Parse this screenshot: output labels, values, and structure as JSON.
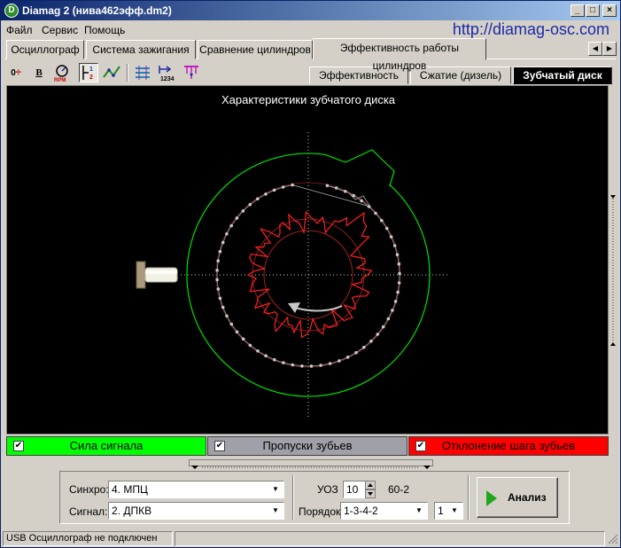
{
  "window": {
    "title": "Diamag 2 (нива462эфф.dm2)",
    "controls": [
      "_",
      "□",
      "×"
    ]
  },
  "menu": [
    "Файл",
    "Сервис",
    "Помощь"
  ],
  "site_url": "http://diamag-osc.com",
  "main_tabs": [
    {
      "label": "Осциллограф"
    },
    {
      "label": "Система зажигания"
    },
    {
      "label": "Сравнение цилиндров"
    },
    {
      "label": "Эффективность работы цилиндров",
      "active": true
    }
  ],
  "toolbar_icons": [
    "zero-offset-icon",
    "bold-icon",
    "rpm-icon",
    "channel-scale-icon",
    "curve-icon",
    "grid-icon",
    "cylinder-numbering-icon",
    "marker-icon"
  ],
  "sub_tabs": [
    {
      "label": "Эффективность"
    },
    {
      "label": "Сжатие (дизель)"
    },
    {
      "label": "Зубчатый диск",
      "active": true
    }
  ],
  "plot": {
    "title": "Характеристики зубчатого диска"
  },
  "legend": [
    {
      "label": "Сила сигнала",
      "checked": true,
      "color": "#00ff00"
    },
    {
      "label": "Пропуски зубьев",
      "checked": true,
      "color": "#a0a0a8"
    },
    {
      "label": "Отклонение шага зубьев",
      "checked": true,
      "color": "#ff0000"
    }
  ],
  "controls": {
    "sync_label": "Синхро:",
    "sync_value": "4.  МПЦ",
    "signal_label": "Сигнал:",
    "signal_value": "2.  ДПКВ",
    "uoz_label": "УОЗ",
    "uoz_value": "10",
    "teeth_text": "60-2",
    "order_label": "Порядок",
    "order_value": "1-3-4-2",
    "cyl_value": "1",
    "analyze_label": "Анализ"
  },
  "status": {
    "text": "USB Осциллограф не подключен"
  }
}
